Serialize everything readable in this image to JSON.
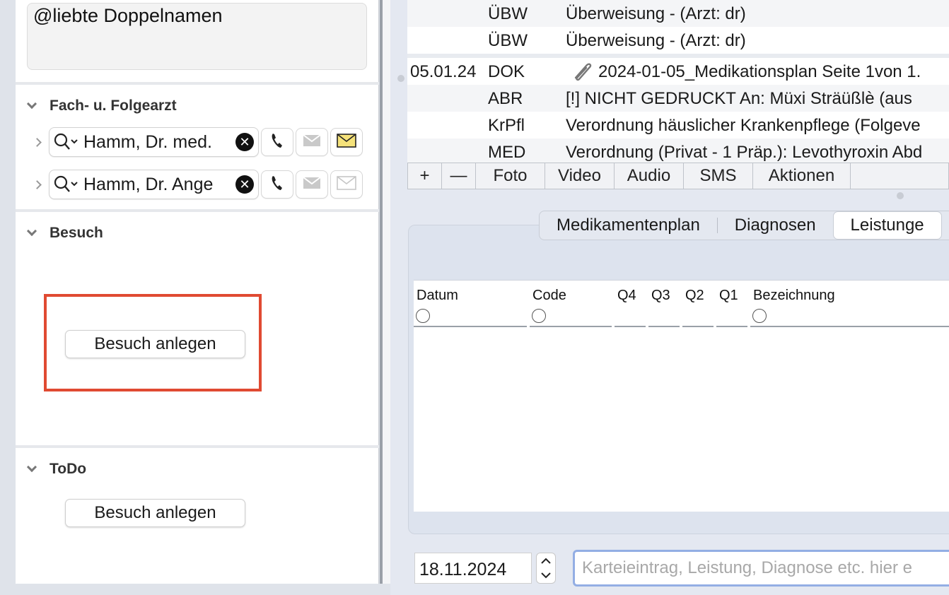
{
  "notes": {
    "text": "@liebte Doppelnamen"
  },
  "fachaerzte": {
    "title": "Fach- u. Folgearzt",
    "doctors": [
      {
        "name": "Hamm, Dr. med."
      },
      {
        "name": "Hamm, Dr. Ange"
      }
    ]
  },
  "besuch": {
    "title": "Besuch",
    "button_label": "Besuch anlegen"
  },
  "todo": {
    "title": "ToDo",
    "button_label": "Besuch anlegen"
  },
  "journal": {
    "rows": [
      {
        "date": "",
        "type": "ÜBW",
        "text": "Überweisung -  (Arzt: dr)"
      },
      {
        "date": "",
        "type": "ÜBW",
        "text": "Überweisung -  (Arzt: dr)"
      },
      {
        "date": "05.01.24",
        "type": "DOK",
        "text": "2024-01-05_Medikationsplan Seite 1von 1."
      },
      {
        "date": "",
        "type": "ABR",
        "text": "[!] NICHT GEDRUCKT An:  Müxi Sträüßlè (aus"
      },
      {
        "date": "",
        "type": "KrPfl",
        "text": "Verordnung häuslicher Krankenpflege (Folgeve"
      },
      {
        "date": "",
        "type": "MED",
        "text": "Verordnung (Privat - 1 Präp.): Levothyroxin Abd"
      }
    ]
  },
  "journal_toolbar": {
    "plus": "+",
    "minus": "—",
    "foto": "Foto",
    "video": "Video",
    "audio": "Audio",
    "sms": "SMS",
    "aktionen": "Aktionen"
  },
  "tabs": {
    "medikamentenplan": "Medikamentenplan",
    "diagnosen": "Diagnosen",
    "leistungen": "Leistunge"
  },
  "table": {
    "columns": {
      "datum": "Datum",
      "code": "Code",
      "q4": "Q4",
      "q3": "Q3",
      "q2": "Q2",
      "q1": "Q1",
      "bezeichnung": "Bezeichnung"
    }
  },
  "entry": {
    "date": "18.11.2024",
    "placeholder": "Karteieintrag, Leistung, Diagnose etc. hier e"
  }
}
